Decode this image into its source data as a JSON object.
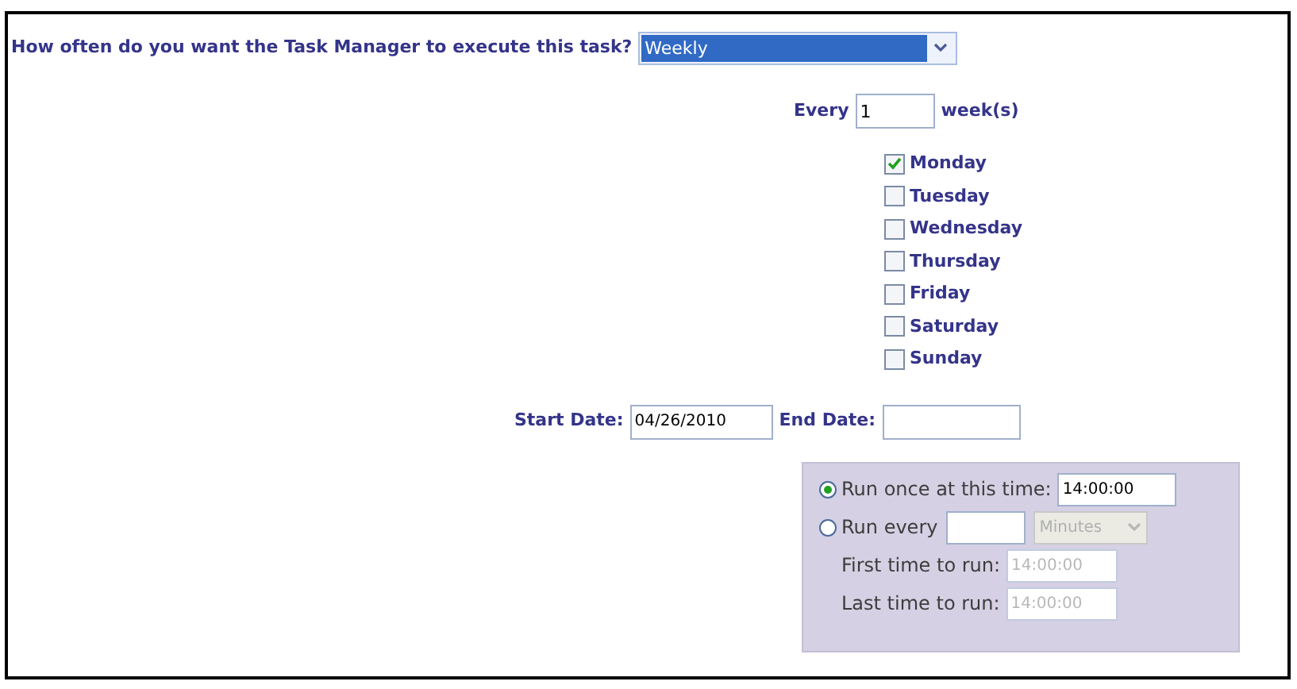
{
  "question": {
    "label": "How often do you want the Task Manager to execute this task?",
    "value": "Weekly"
  },
  "recurrence": {
    "prefix": "Every",
    "value": "1",
    "suffix": "week(s)"
  },
  "days": [
    {
      "label": "Monday",
      "checked": true
    },
    {
      "label": "Tuesday",
      "checked": false
    },
    {
      "label": "Wednesday",
      "checked": false
    },
    {
      "label": "Thursday",
      "checked": false
    },
    {
      "label": "Friday",
      "checked": false
    },
    {
      "label": "Saturday",
      "checked": false
    },
    {
      "label": "Sunday",
      "checked": false
    }
  ],
  "dates": {
    "start_label": "Start Date:",
    "start_value": "04/26/2010",
    "end_label": "End Date:"
  },
  "schedule": {
    "options": [
      {
        "kind": "once",
        "label": "Run once at this time:",
        "value": "14:00:00",
        "selected": true
      },
      {
        "kind": "every",
        "label": "Run every",
        "unit": "Minutes",
        "unit_disabled": true,
        "selected": false
      }
    ],
    "times": [
      {
        "label": "First time to run:",
        "value": "14:00:00",
        "disabled": true
      },
      {
        "label": "Last time to run:",
        "value": "14:00:00",
        "disabled": true
      }
    ]
  }
}
